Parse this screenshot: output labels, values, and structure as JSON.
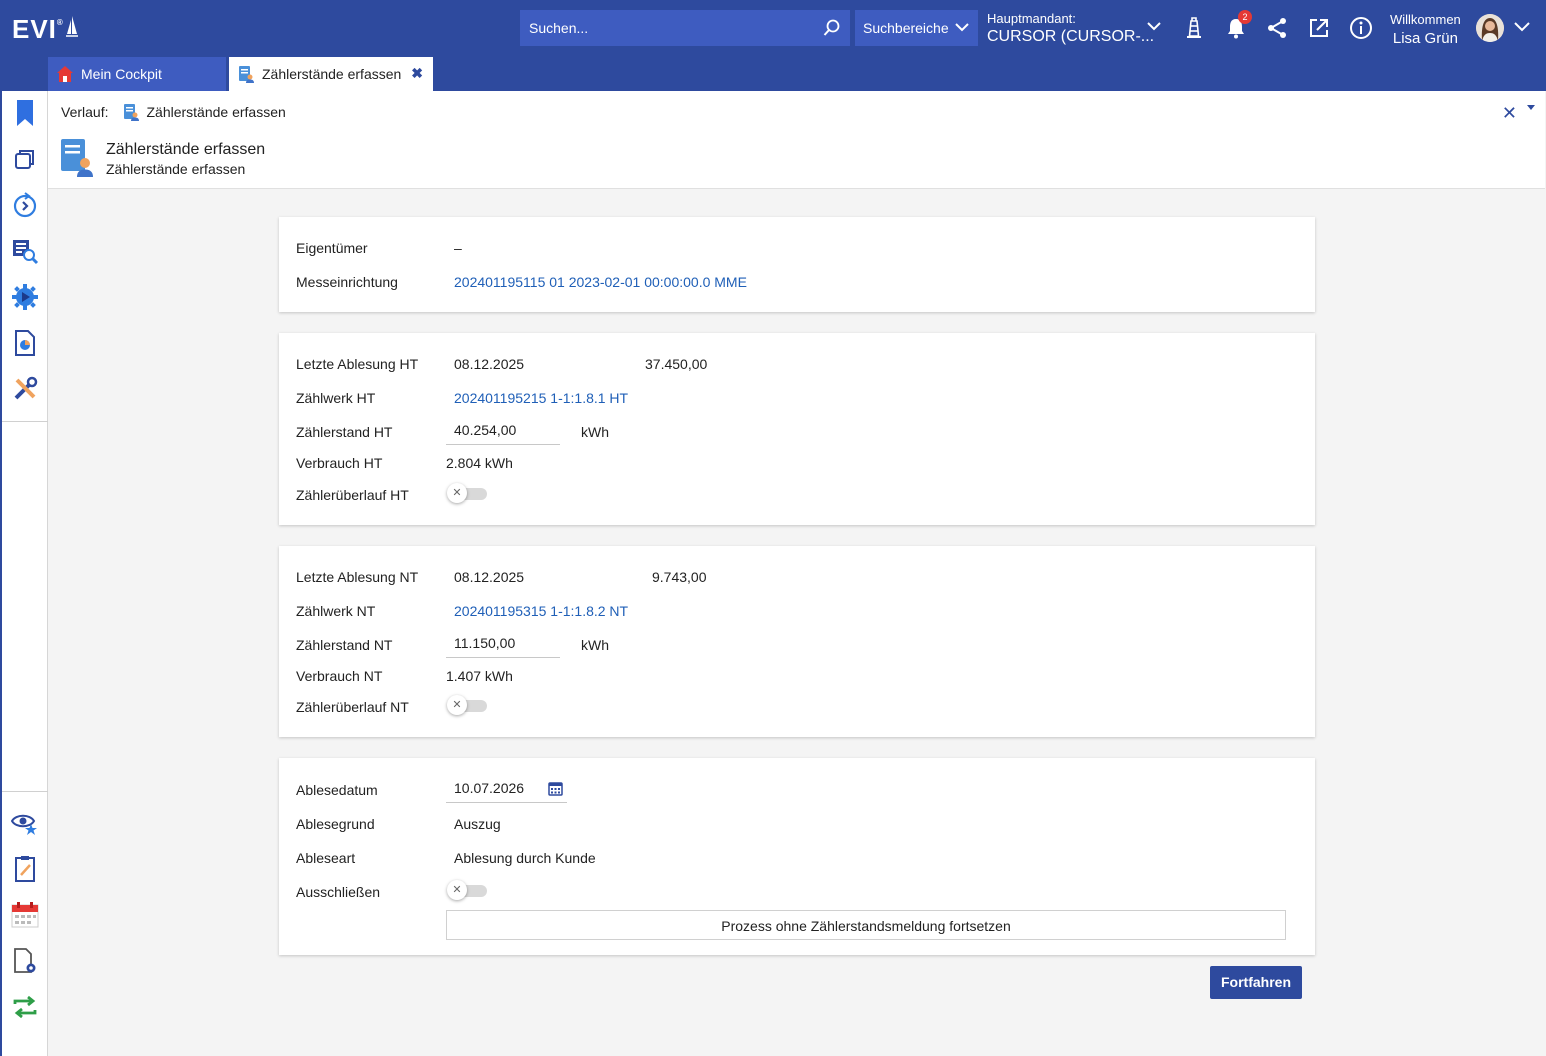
{
  "header": {
    "logo": "EVI",
    "logo_mark": "®",
    "search_placeholder": "Suchen...",
    "scope_label": "Suchbereiche",
    "mandant_label": "Hauptmandant:",
    "mandant_value": "CURSOR (CURSOR-...",
    "notification_count": "2",
    "welcome_label": "Willkommen",
    "user_name": "Lisa Grün",
    "accent_color": "#2e4a9e"
  },
  "tabs": [
    {
      "label": "Mein Cockpit",
      "icon": "home-icon"
    },
    {
      "label": "Zählerstände erfassen",
      "icon": "meter-reading-icon",
      "close": "✖"
    }
  ],
  "breadcrumb": {
    "label": "Verlauf:",
    "item": "Zählerstände erfassen"
  },
  "page": {
    "title": "Zählerstände erfassen",
    "subtitle": "Zählerstände erfassen"
  },
  "owner_card": {
    "owner_label": "Eigentümer",
    "owner_value": "–",
    "device_label": "Messeinrichtung",
    "device_value": "202401195115 01 2023-02-01 00:00:00.0 MME"
  },
  "ht_card": {
    "last_reading_label": "Letzte Ablesung HT",
    "last_reading_date": "08.12.2025",
    "last_reading_value": "37.450,00",
    "register_label": "Zählwerk HT",
    "register_value": "202401195215 1-1:1.8.1 HT",
    "reading_label": "Zählerstand HT",
    "reading_value": "40.254,00",
    "reading_unit": "kWh",
    "consumption_label": "Verbrauch HT",
    "consumption_value": "2.804 kWh",
    "overflow_label": "Zählerüberlauf HT",
    "overflow_on": false
  },
  "nt_card": {
    "last_reading_label": "Letzte Ablesung NT",
    "last_reading_date": "08.12.2025",
    "last_reading_value": "9.743,00",
    "register_label": "Zählwerk NT",
    "register_value": "202401195315 1-1:1.8.2 NT",
    "reading_label": "Zählerstand NT",
    "reading_value": "11.150,00",
    "reading_unit": "kWh",
    "consumption_label": "Verbrauch NT",
    "consumption_value": "1.407 kWh",
    "overflow_label": "Zählerüberlauf NT",
    "overflow_on": false
  },
  "reading_card": {
    "date_label": "Ablesedatum",
    "date_value": "10.07.2026",
    "reason_label": "Ablesegrund",
    "reason_value": "Auszug",
    "type_label": "Ableseart",
    "type_value": "Ablesung durch Kunde",
    "exclude_label": "Ausschließen",
    "exclude_on": false,
    "skip_button": "Prozess ohne Zählerstandsmeldung fortsetzen"
  },
  "actions": {
    "continue_button": "Fortfahren"
  }
}
